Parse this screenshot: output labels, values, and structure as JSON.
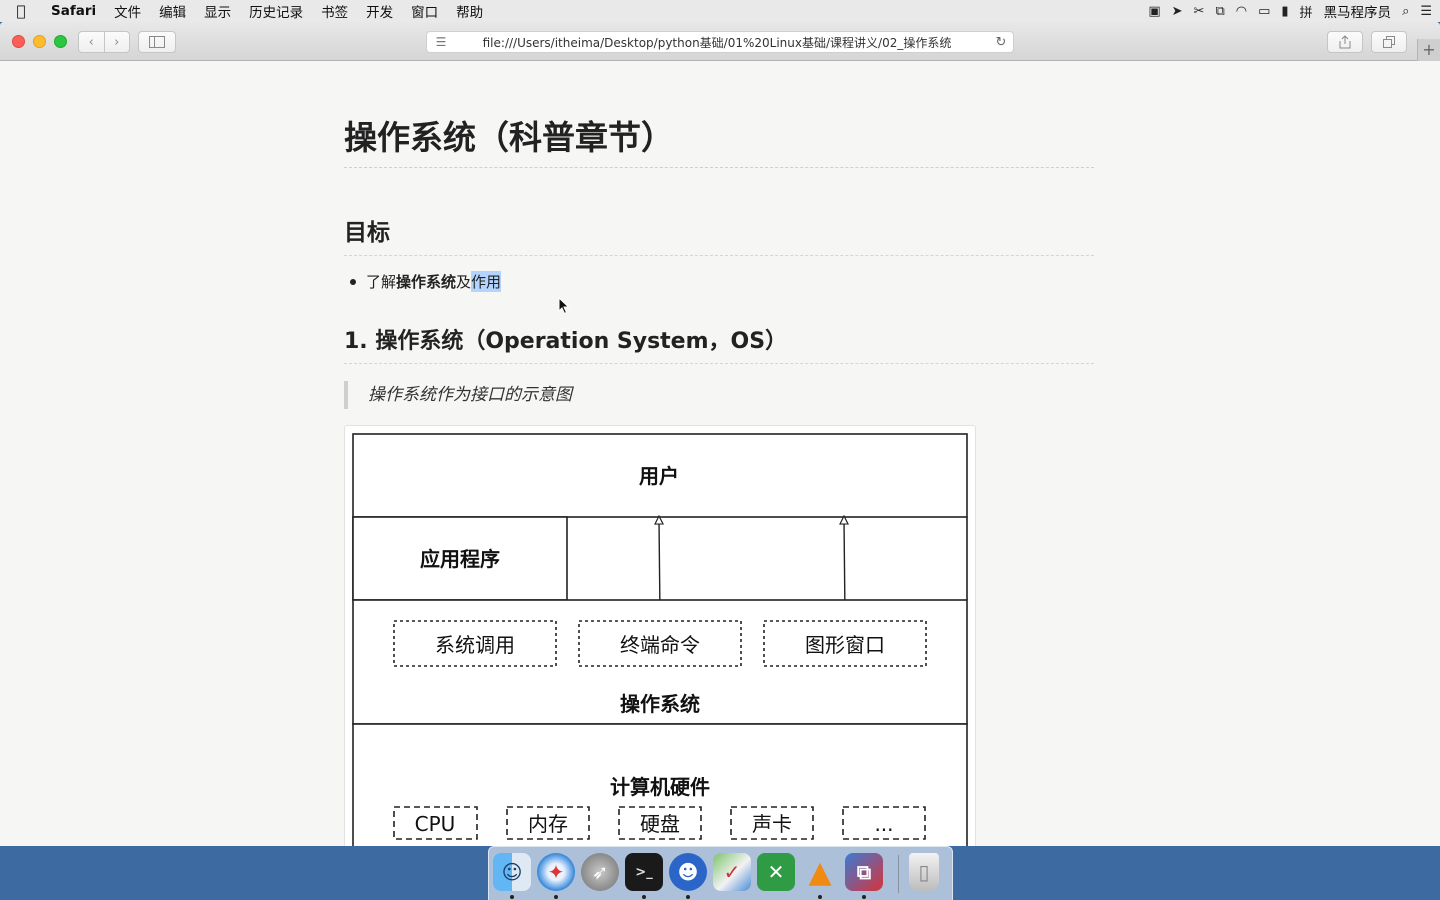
{
  "menubar": {
    "app_name": "Safari",
    "items": [
      "文件",
      "编辑",
      "显示",
      "历史记录",
      "书签",
      "开发",
      "窗口",
      "帮助"
    ],
    "user": "黑马程序员"
  },
  "browser": {
    "url": "file:///Users/itheima/Desktop/python基础/01%20Linux基础/课程讲义/02_操作系统"
  },
  "document": {
    "title": "操作系统（科普章节）",
    "section_goal": "目标",
    "bullet_prefix": "了解",
    "bullet_bold": "操作系统",
    "bullet_mid": "及",
    "bullet_selected": "作用",
    "section_1": "1. 操作系统（Operation System，OS）",
    "quote": "操作系统作为接口的示意图"
  },
  "diagram": {
    "user": "用户",
    "application": "应用程序",
    "os_components": [
      "系统调用",
      "终端命令",
      "图形窗口"
    ],
    "os": "操作系统",
    "hardware": "计算机硬件",
    "hardware_components": [
      "CPU",
      "内存",
      "硬盘",
      "声卡",
      "..."
    ]
  },
  "dock": {
    "apps": [
      "finder-icon",
      "safari-icon",
      "launchpad-icon",
      "terminal-icon",
      "chat-icon",
      "maps-icon",
      "xmind-icon",
      "vlc-icon",
      "parallels-icon",
      "trash-icon"
    ]
  }
}
